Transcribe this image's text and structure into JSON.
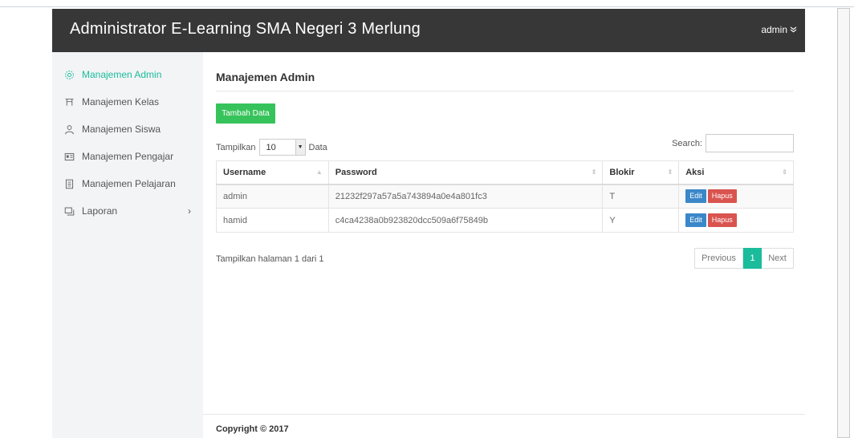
{
  "header": {
    "brand": "Administrator E-Learning SMA Negeri 3 Merlung",
    "user": "admin"
  },
  "sidebar": {
    "items": [
      {
        "label": "Manajemen Admin",
        "icon": "gear-icon",
        "active": true
      },
      {
        "label": "Manajemen Kelas",
        "icon": "class-icon"
      },
      {
        "label": "Manajemen Siswa",
        "icon": "user-icon"
      },
      {
        "label": "Manajemen Pengajar",
        "icon": "id-card-icon"
      },
      {
        "label": "Manajemen Pelajaran",
        "icon": "book-icon"
      },
      {
        "label": "Laporan",
        "icon": "report-icon",
        "has_submenu": true
      }
    ]
  },
  "main": {
    "title": "Manajemen Admin",
    "add_button": "Tambah Data",
    "length_prefix": "Tampilkan",
    "length_value": "10",
    "length_suffix": "Data",
    "search_label": "Search:",
    "search_value": "",
    "columns": [
      "Username",
      "Password",
      "Blokir",
      "Aksi"
    ],
    "rows": [
      {
        "username": "admin",
        "password": "21232f297a57a5a743894a0e4a801fc3",
        "blokir": "T"
      },
      {
        "username": "hamid",
        "password": "c4ca4238a0b923820dcc509a6f75849b",
        "blokir": "Y"
      }
    ],
    "edit_label": "Edit",
    "delete_label": "Hapus",
    "info": "Tampilkan halaman 1 dari 1",
    "pager": {
      "prev": "Previous",
      "current": "1",
      "next": "Next"
    }
  },
  "footer": {
    "text": "Copyright © 2017"
  },
  "colors": {
    "navbar": "#373737",
    "accent": "#1abc9c",
    "add_button": "#37c35b",
    "edit": "#3a87c9",
    "delete": "#d9534f"
  }
}
